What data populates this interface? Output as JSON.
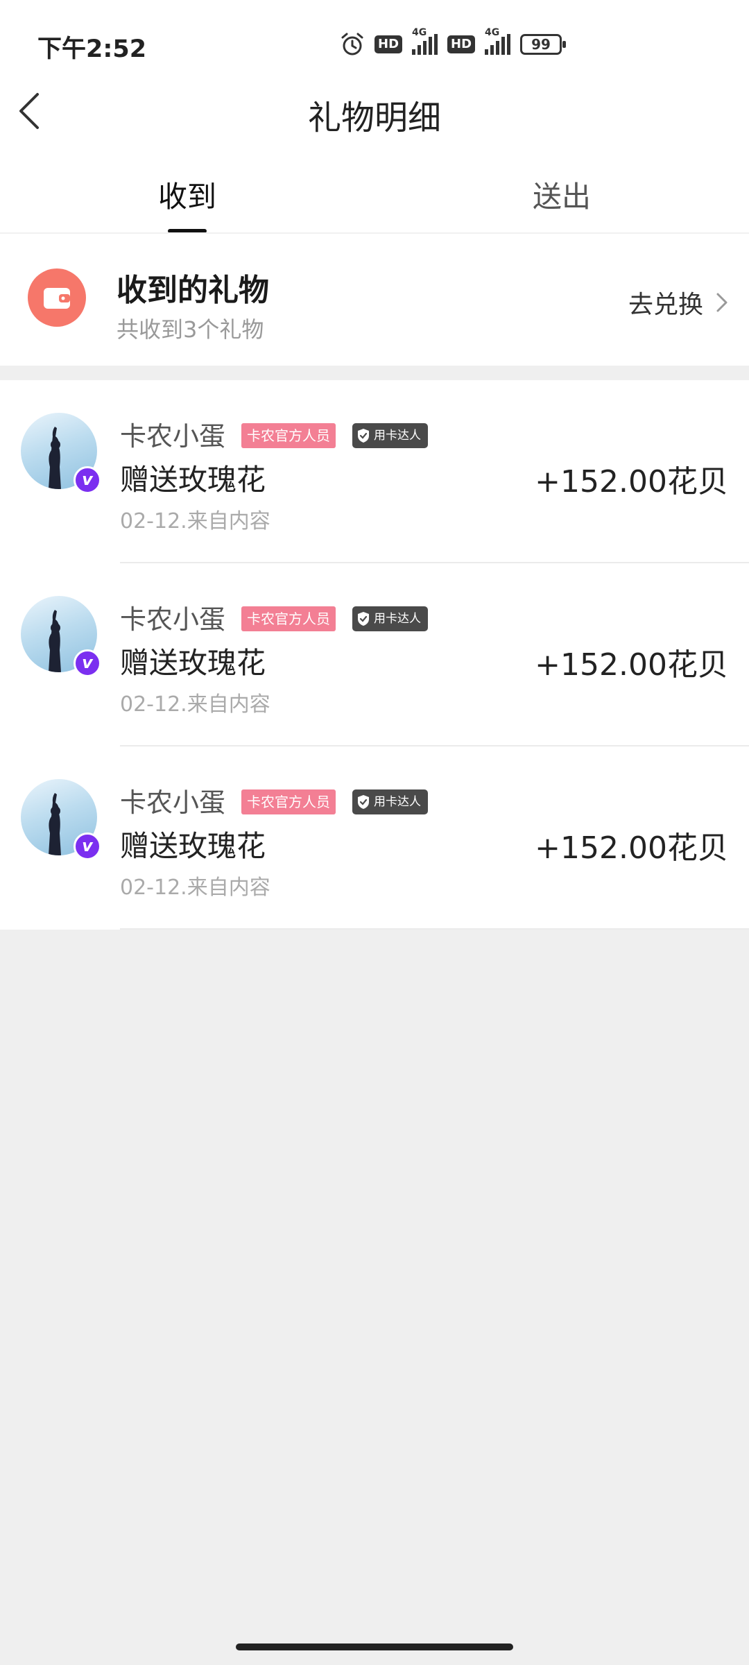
{
  "status_bar": {
    "time": "下午2:52",
    "hd_label": "HD",
    "network_label": "4G",
    "battery": "99",
    "icons": [
      "alarm-icon",
      "hd-icon",
      "signal-icon",
      "hd-icon",
      "signal-icon",
      "battery-icon"
    ]
  },
  "header": {
    "title": "礼物明细",
    "back_icon": "chevron-left-icon",
    "tabs": [
      {
        "label": "收到",
        "active": true
      },
      {
        "label": "送出",
        "active": false
      }
    ]
  },
  "summary": {
    "icon": "wallet-icon",
    "title": "收到的礼物",
    "subtitle": "共收到3个礼物",
    "action_label": "去兑换",
    "action_icon": "chevron-right-icon"
  },
  "records": [
    {
      "user": "卡农小蛋",
      "badge_official": "卡农官方人员",
      "badge_expert": "用卡达人",
      "gift": "赠送玫瑰花",
      "amount": "+152.00花贝",
      "date_source": "02-12.来自内容"
    },
    {
      "user": "卡农小蛋",
      "badge_official": "卡农官方人员",
      "badge_expert": "用卡达人",
      "gift": "赠送玫瑰花",
      "amount": "+152.00花贝",
      "date_source": "02-12.来自内容"
    },
    {
      "user": "卡农小蛋",
      "badge_official": "卡农官方人员",
      "badge_expert": "用卡达人",
      "gift": "赠送玫瑰花",
      "amount": "+152.00花贝",
      "date_source": "02-12.来自内容"
    }
  ],
  "colors": {
    "accent_wallet": "#f6776a",
    "official_tag": "#f37f94",
    "expert_tag": "#4a4a4a",
    "verified_badge": "#7b2ff0"
  }
}
